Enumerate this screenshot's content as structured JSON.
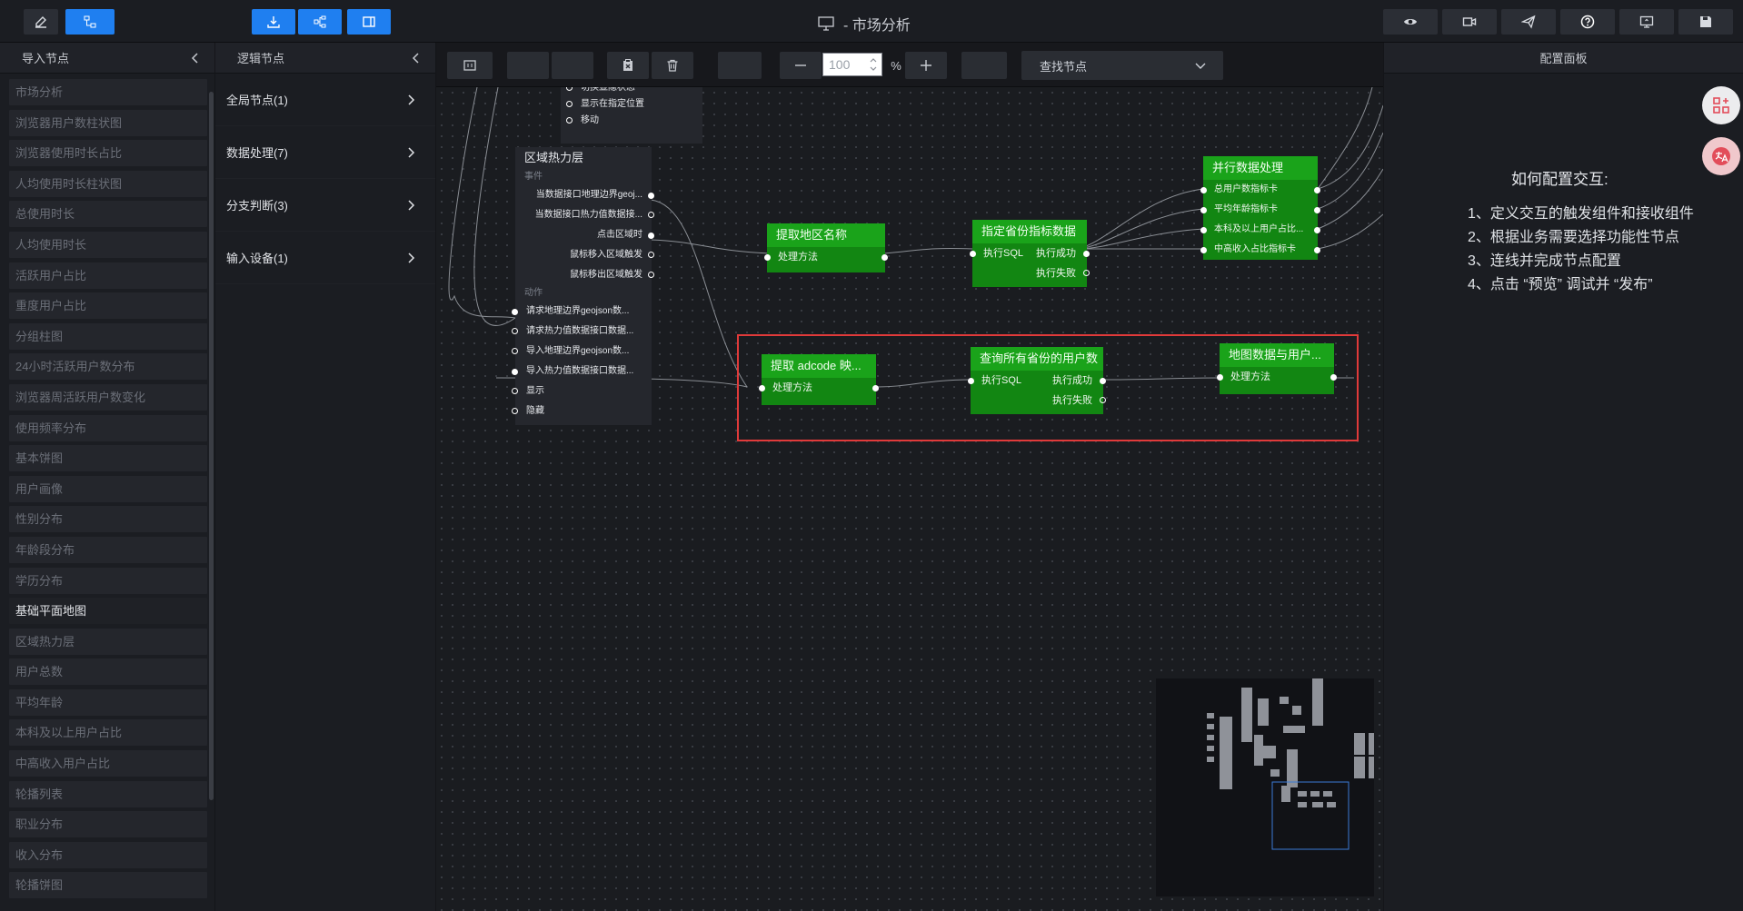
{
  "app": {
    "title": "- 市场分析"
  },
  "left_panel": {
    "title": "导入节点",
    "items": [
      "市场分析",
      "浏览器用户数柱状图",
      "浏览器使用时长占比",
      "人均使用时长柱状图",
      "总使用时长",
      "人均使用时长",
      "活跃用户占比",
      "重度用户占比",
      "分组柱图",
      "24小时活跃用户数分布",
      "浏览器周活跃用户数变化",
      "使用频率分布",
      "基本饼图",
      "用户画像",
      "性别分布",
      "年龄段分布",
      "学历分布",
      "基础平面地图",
      "区域热力层",
      "用户总数",
      "平均年龄",
      "本科及以上用户占比",
      "中高收入用户占比",
      "轮播列表",
      "职业分布",
      "收入分布",
      "轮播饼图"
    ],
    "active_index": 17
  },
  "logic_panel": {
    "title": "逻辑节点",
    "categories": [
      "全局节点(1)",
      "数据处理(7)",
      "分支判断(3)",
      "输入设备(1)"
    ]
  },
  "canvas_toolbar": {
    "zoom_value": "100",
    "zoom_unit": "%",
    "find_placeholder": "查找节点"
  },
  "canvas": {
    "top_fragment": [
      "切换显隐状态",
      "显示在指定位置",
      "移动"
    ],
    "heat_node": {
      "title": "区域热力层",
      "events_label": "事件",
      "events": [
        "当数据接口地理边界geoj...",
        "当数据接口热力值数据接...",
        "点击区域时",
        "鼠标移入区域触发",
        "鼠标移出区域触发"
      ],
      "actions_label": "动作",
      "actions": [
        "请求地理边界geojson数...",
        "请求热力值数据接口数据...",
        "导入地理边界geojson数...",
        "导入热力值数据接口数据...",
        "显示",
        "隐藏"
      ]
    },
    "nodes": {
      "extract_region": {
        "title": "提取地区名称",
        "ports": [
          "处理方法"
        ]
      },
      "province_metrics": {
        "title": "指定省份指标数据",
        "in": "执行SQL",
        "ok": "执行成功",
        "fail": "执行失败"
      },
      "parallel": {
        "title": "并行数据处理",
        "ports": [
          "总用户数指标卡",
          "平均年龄指标卡",
          "本科及以上用户占比...",
          "中高收入占比指标卡"
        ]
      },
      "adcode": {
        "title": "提取 adcode 映...",
        "ports": [
          "处理方法"
        ]
      },
      "query_users": {
        "title": "查询所有省份的用户数",
        "in": "执行SQL",
        "ok": "执行成功",
        "fail": "执行失败"
      },
      "map_data": {
        "title": "地图数据与用户...",
        "ports": [
          "处理方法"
        ]
      }
    }
  },
  "right_panel": {
    "title": "配置面板",
    "help_title": "如何配置交互:",
    "steps": [
      "1、定义交互的触发组件和接收组件",
      "2、根据业务需要选择功能性节点",
      "3、连线并完成节点配置",
      "4、点击 “预览” 调试并 “发布”"
    ]
  },
  "colors": {
    "accent": "#1f7ff0",
    "node_header": "#1aa31a",
    "node_body": "#128612",
    "highlight": "#e03a3a"
  }
}
